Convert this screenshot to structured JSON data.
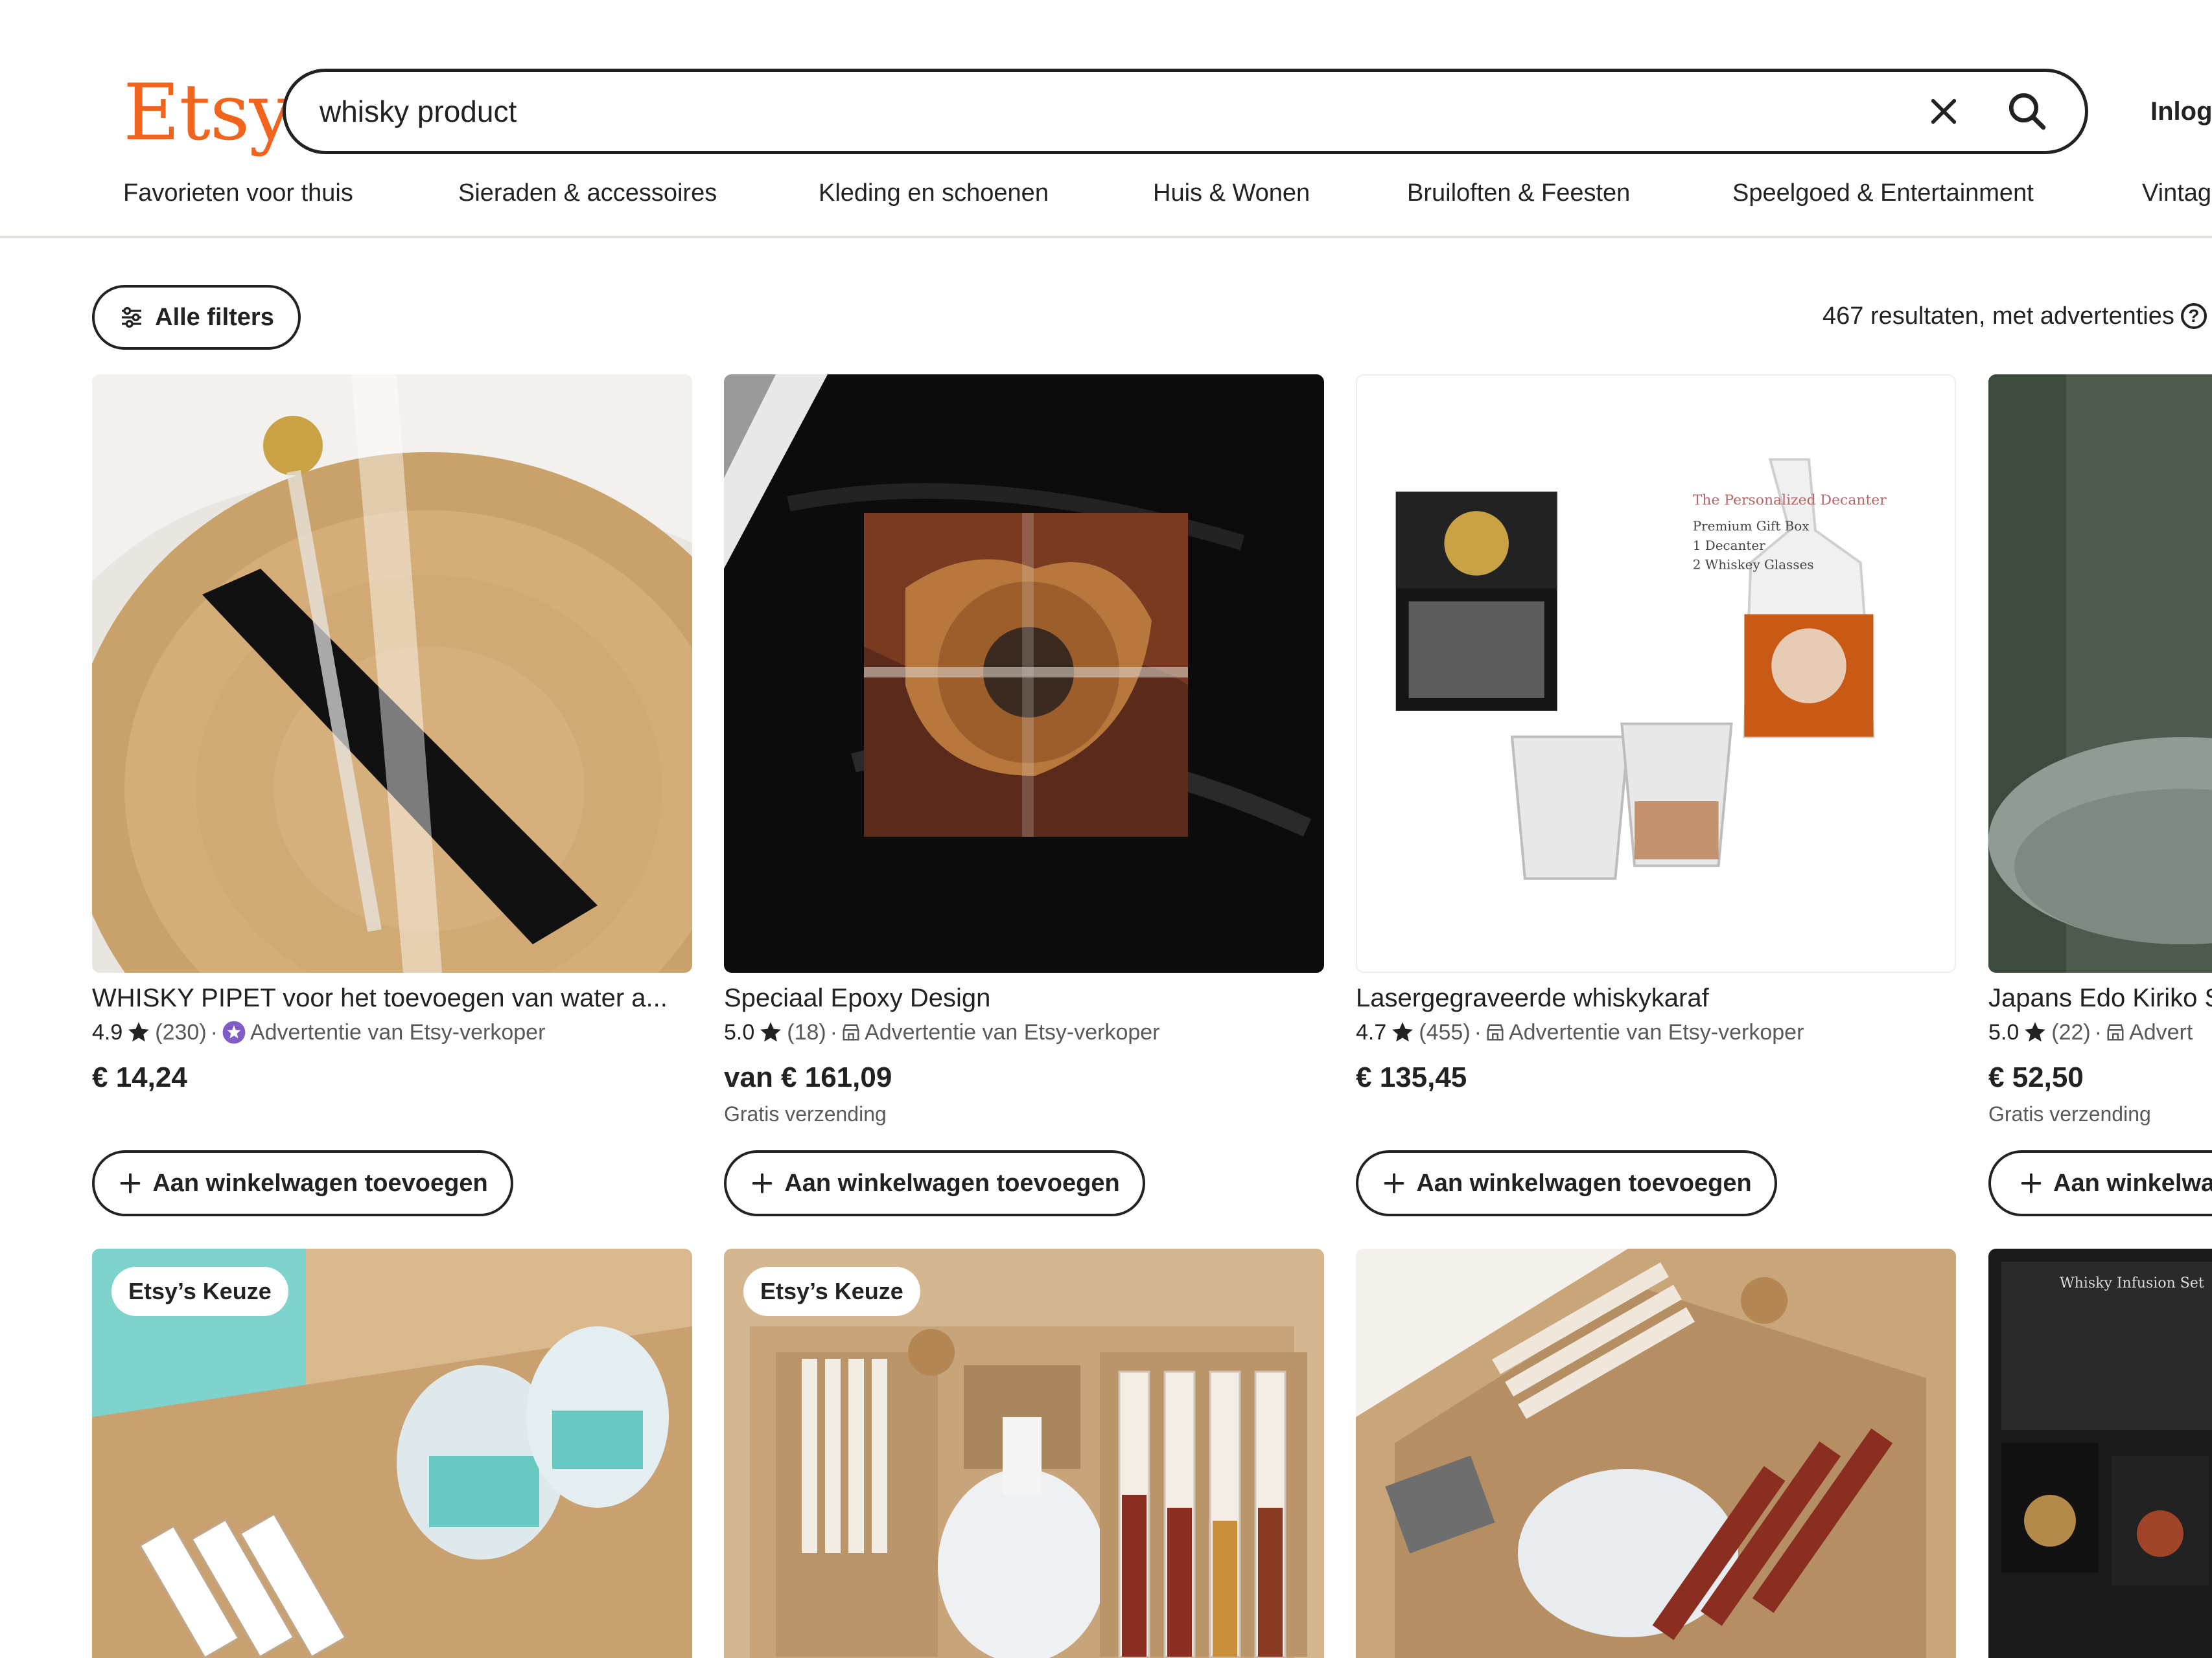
{
  "header": {
    "logo": "Etsy",
    "search": {
      "value": "whisky product"
    },
    "signin_label": "Inlogg"
  },
  "categories": [
    "Favorieten voor thuis",
    "Sieraden & accessoires",
    "Kleding en schoenen",
    "Huis & Wonen",
    "Bruiloften & Feesten",
    "Speelgoed & Entertainment",
    "Vintag"
  ],
  "filters": {
    "all_filters_label": "Alle filters",
    "results_text": "467 resultaten, met advertenties",
    "help_glyph": "?"
  },
  "cart_label": "Aan winkelwagen toevoegen",
  "cart_label_clipped": "Aan winkelwa",
  "colors": {
    "brand": "#F1641E",
    "star": "#222222",
    "badge_purple": "#7F5CC7"
  },
  "products": [
    {
      "title": "WHISKY PIPET voor het toevoegen van water a...",
      "rating": "4.9",
      "reviews": "(230)",
      "ad_label": "Advertentie van Etsy-verkoper",
      "price": "€ 14,24",
      "shipping": "",
      "has_video": true
    },
    {
      "title": "Speciaal Epoxy Design",
      "rating": "5.0",
      "reviews": "(18)",
      "ad_label": "Advertentie van Etsy-verkoper",
      "price": "van € 161,09",
      "shipping": "Gratis verzending"
    },
    {
      "title": "Lasergegraveerde whiskykaraf",
      "rating": "4.7",
      "reviews": "(455)",
      "ad_label": "Advertentie van Etsy-verkoper",
      "price": "€ 135,45",
      "shipping": ""
    },
    {
      "title": "Japans Edo Kiriko S",
      "rating": "5.0",
      "reviews": "(22)",
      "ad_label": "Advert",
      "price": "€ 52,50",
      "shipping": "Gratis verzending"
    }
  ],
  "second_row": {
    "badge": "Etsy’s Keuze"
  }
}
